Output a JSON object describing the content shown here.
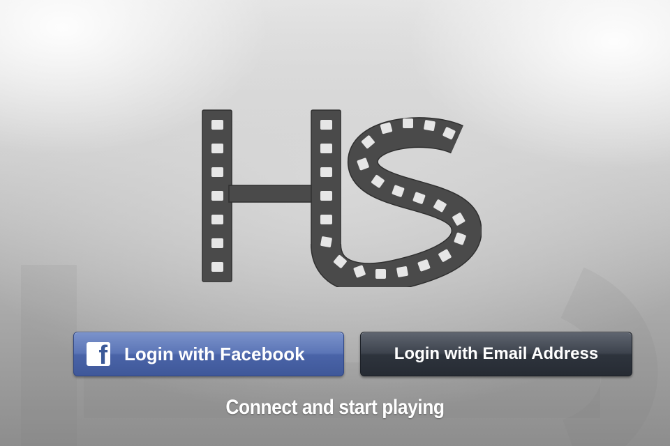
{
  "logo": {
    "text": "HS",
    "color": "#4a4a4a"
  },
  "buttons": {
    "facebook": {
      "label": "Login with Facebook",
      "icon": "facebook-f-icon",
      "color": "#4a64a8"
    },
    "email": {
      "label": "Login with Email Address",
      "color": "#2e343d"
    }
  },
  "tagline": "Connect and start playing"
}
